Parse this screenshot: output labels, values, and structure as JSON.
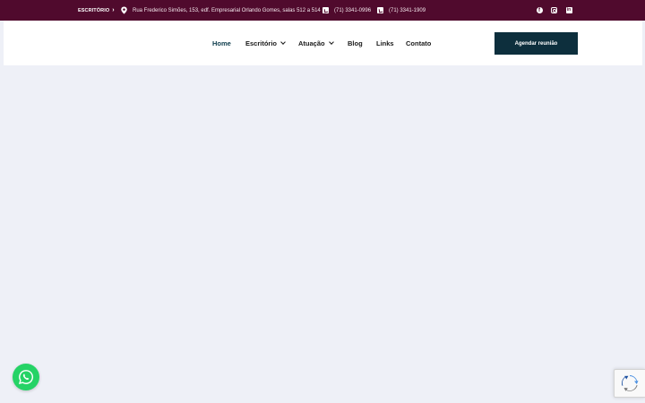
{
  "topbar": {
    "escritorio_label": "ESCRITÓRIO",
    "escritorio_chevron": "›",
    "address": "Rua Frederico Simões, 153, edf. Empresarial Orlando Gomes, salas 512 a 514",
    "phone1": "(71) 3341-0996",
    "phone2": "(71) 3341-1909",
    "social": {
      "facebook_glyph": "f",
      "linkedin_glyph": "in"
    },
    "background": "#500a2d"
  },
  "nav": {
    "items": [
      {
        "label": "Home"
      },
      {
        "label": "Escritório"
      },
      {
        "label": "Atuação"
      },
      {
        "label": "Blog"
      },
      {
        "label": "Links"
      },
      {
        "label": "Contato"
      }
    ],
    "active_color": "#0d3c4c"
  },
  "cta": {
    "label": "Agendar reunião",
    "background": "#0d2f3d"
  },
  "colors": {
    "page_background": "#eef0f7",
    "whatsapp": "#25d366"
  },
  "icons": {
    "address": "map-pin-icon",
    "phone": "phone-icon",
    "facebook": "facebook-icon",
    "instagram": "instagram-icon",
    "linkedin": "linkedin-icon",
    "whatsapp": "whatsapp-icon",
    "recaptcha": "recaptcha-icon"
  }
}
